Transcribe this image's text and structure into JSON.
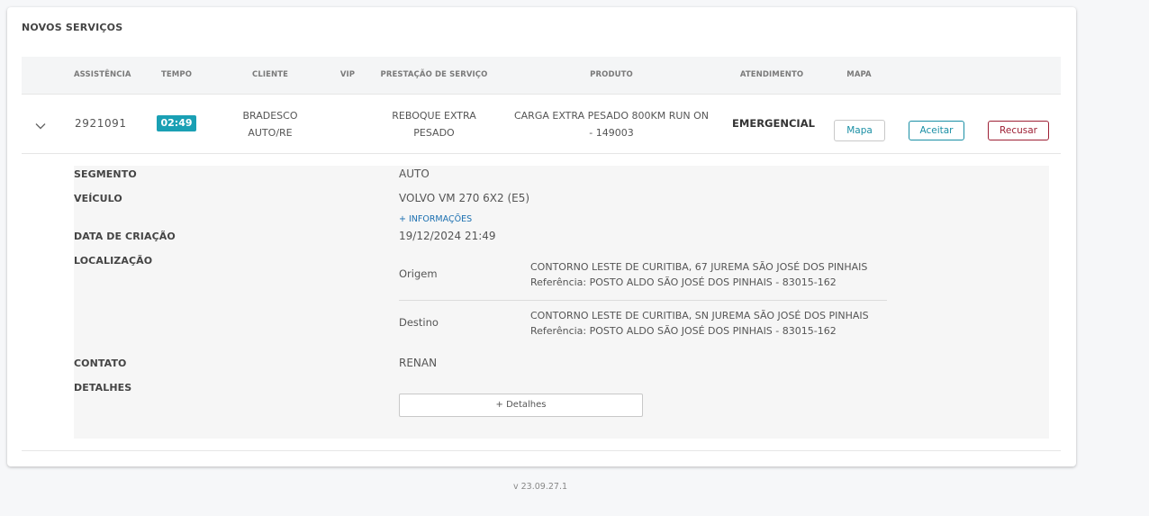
{
  "panel": {
    "title": "NOVOS SERVIÇOS"
  },
  "table": {
    "headers": {
      "assistencia": "ASSISTÊNCIA",
      "tempo": "TEMPO",
      "cliente": "CLIENTE",
      "vip": "VIP",
      "prestacao": "PRESTAÇÃO DE SERVIÇO",
      "produto": "PRODUTO",
      "atendimento": "ATENDIMENTO",
      "mapa": "MAPA"
    },
    "row": {
      "assistencia": "2921091",
      "tempo": "02:49",
      "cliente": "BRADESCO AUTO/RE",
      "vip": "",
      "prestacao": "REBOQUE EXTRA PESADO",
      "produto": "CARGA EXTRA PESADO 800KM RUN ON - 149003",
      "atendimento": "EMERGENCIAL",
      "mapa_button": "Mapa",
      "accept_button": "Aceitar",
      "refuse_button": "Recusar"
    }
  },
  "details": {
    "segmento_label": "SEGMENTO",
    "segmento": "AUTO",
    "veiculo_label": "VEÍCULO",
    "veiculo": "VOLVO VM 270 6X2 (E5)",
    "more_info": "+ INFORMAÇÕES",
    "data_label": "DATA DE CRIAÇÃO",
    "data": "19/12/2024 21:49",
    "localizacao_label": "LOCALIZAÇÃO",
    "origem_label": "Origem",
    "origem_endereco": "CONTORNO LESTE DE CURITIBA, 67 JUREMA SÃO JOSÉ DOS PINHAIS",
    "origem_referencia": "Referência: POSTO ALDO SÃO JOSÉ DOS PINHAIS - 83015-162",
    "destino_label": "Destino",
    "destino_endereco": "CONTORNO LESTE DE CURITIBA, SN JUREMA SÃO JOSÉ DOS PINHAIS",
    "destino_referencia": "Referência: POSTO ALDO SÃO JOSÉ DOS PINHAIS - 83015-162",
    "contato_label": "CONTATO",
    "contato": "RENAN",
    "detalhes_label": "DETALHES",
    "detalhes_button": "+ Detalhes"
  },
  "footer": {
    "version": "v 23.09.27.1"
  },
  "icons": {
    "expand": "chevron-down-icon"
  },
  "colors": {
    "accent": "#1aa0b4",
    "refuse": "#9e2035",
    "link": "#1a6fb0"
  }
}
